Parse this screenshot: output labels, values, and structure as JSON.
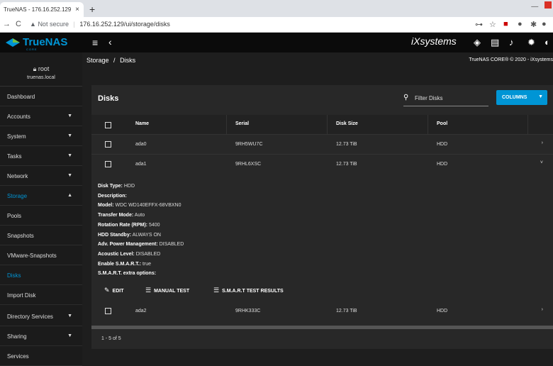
{
  "browser": {
    "tab_title": "TrueNAS - 176.16.252.129",
    "tab_close": "×",
    "new_tab": "+",
    "security_label": "Not secure",
    "url": "176.16.252.129/ui/storage/disks"
  },
  "header": {
    "logo_text": "TrueNAS",
    "logo_sub": "CORE",
    "vendor_logo": "iXsystems",
    "icons": [
      "menu-icon",
      "back-icon",
      "truecommand-icon",
      "clipboard-icon",
      "bell-icon",
      "gear-icon",
      "power-icon"
    ]
  },
  "sidebar": {
    "user": "root",
    "host": "truenas.local",
    "items": [
      {
        "label": "Dashboard",
        "chevron": ""
      },
      {
        "label": "Accounts",
        "chevron": "▼"
      },
      {
        "label": "System",
        "chevron": "▼"
      },
      {
        "label": "Tasks",
        "chevron": "▼"
      },
      {
        "label": "Network",
        "chevron": "▼"
      },
      {
        "label": "Storage",
        "chevron": "▲",
        "active": true
      },
      {
        "label": "Pools",
        "chevron": ""
      },
      {
        "label": "Snapshots",
        "chevron": ""
      },
      {
        "label": "VMware-Snapshots",
        "chevron": ""
      },
      {
        "label": "Disks",
        "chevron": "",
        "active": true
      },
      {
        "label": "Import Disk",
        "chevron": ""
      },
      {
        "label": "Directory Services",
        "chevron": "▼"
      },
      {
        "label": "Sharing",
        "chevron": "▼"
      },
      {
        "label": "Services",
        "chevron": ""
      }
    ]
  },
  "breadcrumb": {
    "parent": "Storage",
    "separator": "/",
    "current": "Disks"
  },
  "copyright": "TrueNAS CORE® © 2020 - iXsystems",
  "disks": {
    "title": "Disks",
    "filter_placeholder": "Filter Disks",
    "columns_button": "COLUMNS",
    "columns": [
      "Name",
      "Serial",
      "Disk Size",
      "Pool"
    ],
    "rows": [
      {
        "name": "ada0",
        "serial": "9RH5WU7C",
        "size": "12.73 TiB",
        "pool": "HDD",
        "chevron": "›"
      },
      {
        "name": "ada1",
        "serial": "9RHL6XSC",
        "size": "12.73 TiB",
        "pool": "HDD",
        "chevron": "˅"
      },
      {
        "name": "ada2",
        "serial": "9RHK333C",
        "size": "12.73 TiB",
        "pool": "HDD",
        "chevron": "›"
      }
    ],
    "detail": {
      "disk_type_label": "Disk Type:",
      "disk_type": "HDD",
      "description_label": "Description:",
      "description": "",
      "model_label": "Model:",
      "model": "WDC WD140EFFX-68VBXN0",
      "transfer_mode_label": "Transfer Mode:",
      "transfer_mode": "Auto",
      "rpm_label": "Rotation Rate (RPM):",
      "rpm": "5400",
      "standby_label": "HDD Standby:",
      "standby": "ALWAYS ON",
      "apm_label": "Adv. Power Management:",
      "apm": "DISABLED",
      "acoustic_label": "Acoustic Level:",
      "acoustic": "DISABLED",
      "smart_label": "Enable S.M.A.R.T.:",
      "smart": "true",
      "smart_opts_label": "S.M.A.R.T. extra options:",
      "smart_opts": ""
    },
    "actions": {
      "edit": "EDIT",
      "manual_test": "MANUAL TEST",
      "smart_results": "S.M.A.R.T TEST RESULTS"
    },
    "pager": "1 - 5 of 5"
  }
}
